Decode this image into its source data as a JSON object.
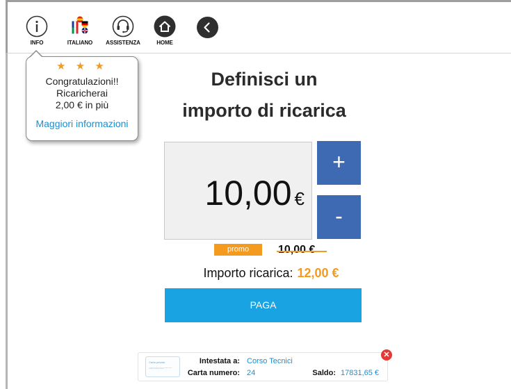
{
  "toolbar": {
    "items": [
      {
        "label": "INFO",
        "icon": "info-icon"
      },
      {
        "label": "ITALIANO",
        "icon": "language-flags-icon"
      },
      {
        "label": "ASSISTENZA",
        "icon": "headset-icon"
      },
      {
        "label": "HOME",
        "icon": "home-icon"
      }
    ],
    "back_icon": "chevron-left-icon"
  },
  "tooltip": {
    "stars": "★ ★ ★",
    "lines": [
      "Congratulazioni!!",
      "Ricaricherai",
      "2,00 € in più"
    ],
    "link": "Maggiori informazioni"
  },
  "main": {
    "title_line1": "Definisci un",
    "title_line2": "importo di ricarica",
    "amount": "10,00",
    "currency": "€",
    "plus_label": "+",
    "minus_label": "-",
    "promo_label": "promo",
    "old_price": "10,00 €",
    "importo_label": "Importo ricarica:",
    "importo_value": "12,00 €",
    "pay_label": "PAGA"
  },
  "card": {
    "thumb_title": "Carta privata",
    "thumb_number": "1234 1234 1234 **** ****",
    "holder_label": "Intestata a:",
    "holder_value": "Corso Tecnici",
    "number_label": "Carta numero:",
    "number_value": "24",
    "balance_label": "Saldo:",
    "balance_value": "17831,65 €",
    "close_icon": "close-icon"
  },
  "colors": {
    "accent_blue": "#3d6ab3",
    "pay_blue": "#1aa3e2",
    "promo_orange": "#f39a1f",
    "link_blue": "#1b8fd1",
    "close_red": "#e53935"
  }
}
